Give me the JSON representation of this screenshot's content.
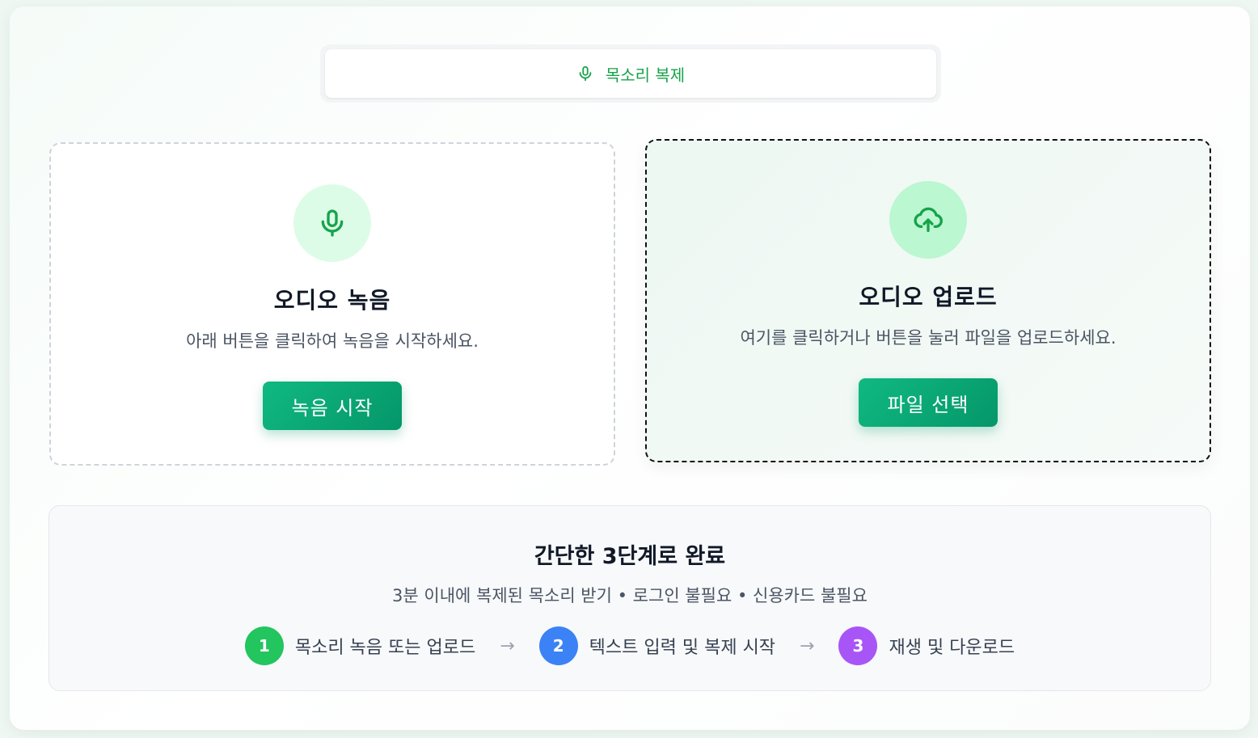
{
  "tab": {
    "label": "목소리 복제",
    "icon": "mic-icon"
  },
  "record": {
    "icon": "mic-icon",
    "title": "오디오 녹음",
    "description": "아래 버튼을 클릭하여 녹음을 시작하세요.",
    "button": "녹음 시작"
  },
  "upload": {
    "icon": "cloud-upload-icon",
    "title": "오디오 업로드",
    "description": "여기를 클릭하거나 버튼을 눌러 파일을 업로드하세요.",
    "button": "파일 선택"
  },
  "steps": {
    "title": "간단한 3단계로 완료",
    "subtitle": "3분 이내에 복제된 목소리 받기 • 로그인 불필요 • 신용카드 불필요",
    "items": [
      {
        "num": "1",
        "label": "목소리 녹음 또는 업로드",
        "color": "#22c55e"
      },
      {
        "num": "2",
        "label": "텍스트 입력 및 복제 시작",
        "color": "#3b82f6"
      },
      {
        "num": "3",
        "label": "재생 및 다운로드",
        "color": "#a855f7"
      }
    ]
  },
  "colors": {
    "accent": "#16a34a",
    "button": "#10b981"
  }
}
